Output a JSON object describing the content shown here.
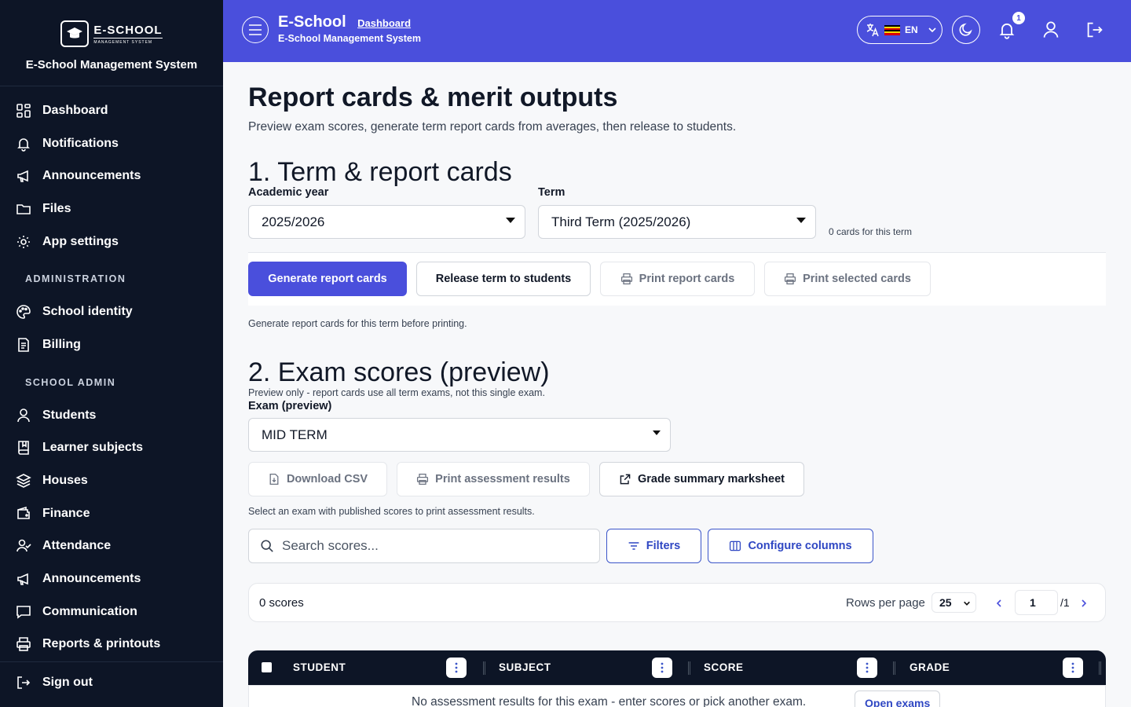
{
  "sidebar": {
    "logo_main": "E-SCHOOL",
    "logo_sub": "MANAGEMENT SYSTEM",
    "system_name": "E-School Management System",
    "items": [
      {
        "label": "Dashboard",
        "icon": "dashboard-icon"
      },
      {
        "label": "Notifications",
        "icon": "bell-icon"
      },
      {
        "label": "Announcements",
        "icon": "megaphone-icon"
      },
      {
        "label": "Files",
        "icon": "folder-icon"
      },
      {
        "label": "App settings",
        "icon": "gear-icon"
      }
    ],
    "section_admin": "ADMINISTRATION",
    "admin_items": [
      {
        "label": "School identity",
        "icon": "palette-icon"
      },
      {
        "label": "Billing",
        "icon": "receipt-icon"
      }
    ],
    "section_school": "SCHOOL ADMIN",
    "school_items": [
      {
        "label": "Students",
        "icon": "user-icon"
      },
      {
        "label": "Learner subjects",
        "icon": "book-icon"
      },
      {
        "label": "Houses",
        "icon": "layers-icon"
      },
      {
        "label": "Finance",
        "icon": "wallet-icon"
      },
      {
        "label": "Attendance",
        "icon": "user-check-icon"
      },
      {
        "label": "Announcements",
        "icon": "megaphone-icon"
      },
      {
        "label": "Communication",
        "icon": "message-icon"
      },
      {
        "label": "Reports & printouts",
        "icon": "printer-icon"
      }
    ],
    "sign_out": "Sign out"
  },
  "topbar": {
    "title": "E-School",
    "breadcrumb": "Dashboard",
    "subtitle": "E-School Management System",
    "lang": "EN",
    "notification_count": "1",
    "accent": "#4a4fdc"
  },
  "main": {
    "title": "Report cards & merit outputs",
    "description": "Preview exam scores, generate term report cards from averages, then release to students.",
    "section1": {
      "heading": "1. Term & report cards",
      "academic_year_label": "Academic year",
      "academic_year_value": "2025/2026",
      "term_label": "Term",
      "term_value": "Third Term (2025/2026)",
      "cards_count": "0 cards for this term",
      "btn_generate": "Generate report cards",
      "btn_release": "Release term to students",
      "btn_print": "Print report cards",
      "btn_print_selected": "Print selected cards",
      "hint": "Generate report cards for this term before printing."
    },
    "section2": {
      "heading": "2. Exam scores (preview)",
      "note": "Preview only - report cards use all term exams, not this single exam.",
      "exam_label": "Exam (preview)",
      "exam_value": "MID TERM",
      "btn_csv": "Download CSV",
      "btn_print_results": "Print assessment results",
      "btn_marksheet": "Grade summary marksheet",
      "hint": "Select an exam with published scores to print assessment results.",
      "search_placeholder": "Search scores...",
      "btn_filters": "Filters",
      "btn_columns": "Configure columns"
    },
    "pager": {
      "count": "0 scores",
      "rows_label": "Rows per page",
      "rows_value": "25",
      "page": "1",
      "total": "/1"
    },
    "table": {
      "columns": [
        "STUDENT",
        "SUBJECT",
        "SCORE",
        "GRADE"
      ],
      "empty_message": "No assessment results for this exam - enter scores or pick another exam.",
      "open_exams": "Open exams"
    }
  }
}
